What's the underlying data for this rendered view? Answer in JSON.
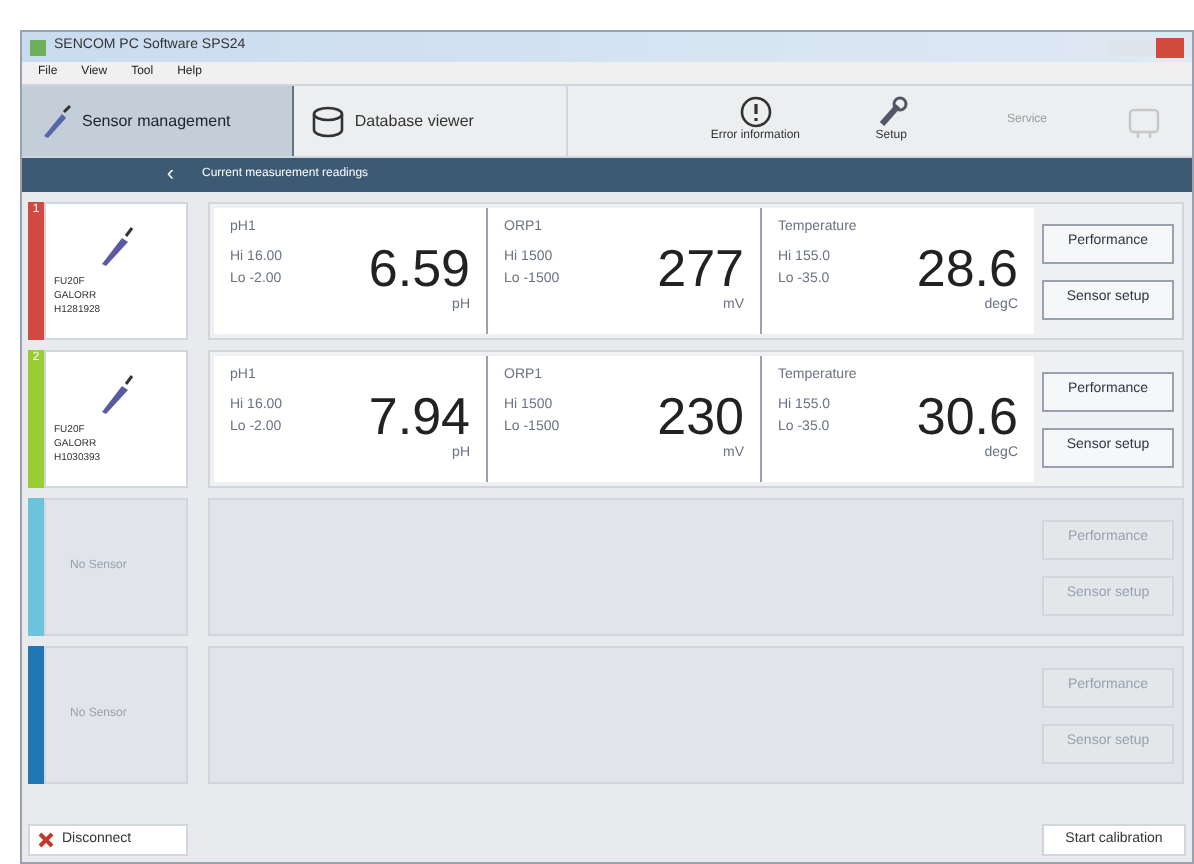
{
  "window": {
    "title": "SENCOM PC Software SPS24"
  },
  "menu": [
    "File",
    "View",
    "Tool",
    "Help"
  ],
  "toolbar": [
    {
      "label": "Sensor management",
      "kind": "tab",
      "selected": true
    },
    {
      "label": "Database viewer",
      "kind": "tab",
      "selected": false
    },
    {
      "label": "Error information",
      "kind": "tool",
      "disabled": false
    },
    {
      "label": "Setup",
      "kind": "tool",
      "disabled": false
    },
    {
      "label": "Service",
      "kind": "tool",
      "disabled": true
    },
    {
      "kind": "tool",
      "disabled": true
    }
  ],
  "section": {
    "back": "‹",
    "title": "Current measurement readings"
  },
  "channels": [
    {
      "number": "1",
      "color": "#d04a42",
      "disabled": false,
      "sensor": [
        "FU20F",
        "GALORR",
        "H1281928"
      ],
      "measurements": [
        {
          "name": "pH1",
          "hi": "Hi 16.00",
          "lo": "Lo -2.00",
          "value": "6.59",
          "unit": "pH"
        },
        {
          "name": "ORP1",
          "hi": "Hi 1500",
          "lo": "Lo -1500",
          "value": "277",
          "unit": "mV"
        },
        {
          "name": "Temperature",
          "hi": "Hi 155.0",
          "lo": "Lo -35.0",
          "value": "28.6",
          "unit": "degC"
        }
      ],
      "buttons": [
        "Performance",
        "Sensor setup"
      ]
    },
    {
      "number": "2",
      "color": "#9acd32",
      "disabled": false,
      "sensor": [
        "FU20F",
        "GALORR",
        "H1030393"
      ],
      "measurements": [
        {
          "name": "pH1",
          "hi": "Hi 16.00",
          "lo": "Lo -2.00",
          "value": "7.94",
          "unit": "pH"
        },
        {
          "name": "ORP1",
          "hi": "Hi 1500",
          "lo": "Lo -1500",
          "value": "230",
          "unit": "mV"
        },
        {
          "name": "Temperature",
          "hi": "Hi 155.0",
          "lo": "Lo -35.0",
          "value": "30.6",
          "unit": "degC"
        }
      ],
      "buttons": [
        "Performance",
        "Sensor setup"
      ]
    },
    {
      "color": "#6cc4dc",
      "disabled": true,
      "sensor": [
        "No Sensor"
      ],
      "buttons": [
        "Performance",
        "Sensor setup"
      ]
    },
    {
      "color": "#1f78b4",
      "disabled": true,
      "sensor": [
        "No Sensor"
      ],
      "buttons": [
        "Performance",
        "Sensor setup"
      ]
    }
  ],
  "footer": {
    "disconnect": "Disconnect",
    "calibration": "Start calibration"
  }
}
